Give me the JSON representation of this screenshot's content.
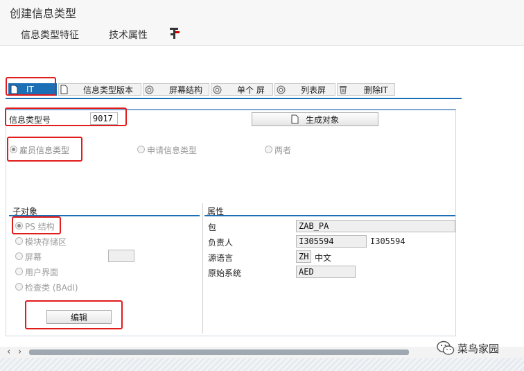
{
  "window": {
    "title": "创建信息类型"
  },
  "toolbar": {
    "items": [
      "信息类型特征",
      "技术属性"
    ],
    "icon": "transport-icon"
  },
  "tabs": [
    {
      "label": "IT",
      "icon": "document-icon"
    },
    {
      "label": "信息类型版本",
      "icon": "document-icon"
    },
    {
      "label": "屏幕结构",
      "icon": "gear-circle-icon"
    },
    {
      "label": "单个 屏",
      "icon": "gear-circle-icon"
    },
    {
      "label": "列表屏",
      "icon": "gear-circle-icon"
    },
    {
      "label": "删除IT",
      "icon": "trash-icon"
    }
  ],
  "form": {
    "infotype_label": "信息类型号",
    "infotype_value": "9017",
    "generate_button": "生成对象",
    "radios": [
      {
        "label": "雇员信息类型",
        "selected": true
      },
      {
        "label": "申请信息类型",
        "selected": false
      },
      {
        "label": "两者",
        "selected": false
      }
    ]
  },
  "sub_objects": {
    "title": "子对象",
    "items": [
      {
        "label": "PS 结构",
        "selected": true
      },
      {
        "label": "模块存储区",
        "selected": false
      },
      {
        "label": "屏幕",
        "selected": false
      },
      {
        "label": "用户界面",
        "selected": false
      },
      {
        "label": "检查类 (BAdI)",
        "selected": false
      }
    ],
    "edit_button": "编辑"
  },
  "attributes": {
    "title": "属性",
    "rows": [
      {
        "label": "包",
        "value": "ZAB_PA",
        "extra": ""
      },
      {
        "label": "负责人",
        "value": "I305594",
        "extra": "I305594"
      },
      {
        "label": "源语言",
        "value": "ZH",
        "extra": "中文"
      },
      {
        "label": "原始系统",
        "value": "AED",
        "extra": ""
      }
    ]
  },
  "watermark": {
    "text": "菜鸟家园"
  },
  "colors": {
    "accent": "#1c6fb5",
    "highlight": "#e21b1b"
  }
}
